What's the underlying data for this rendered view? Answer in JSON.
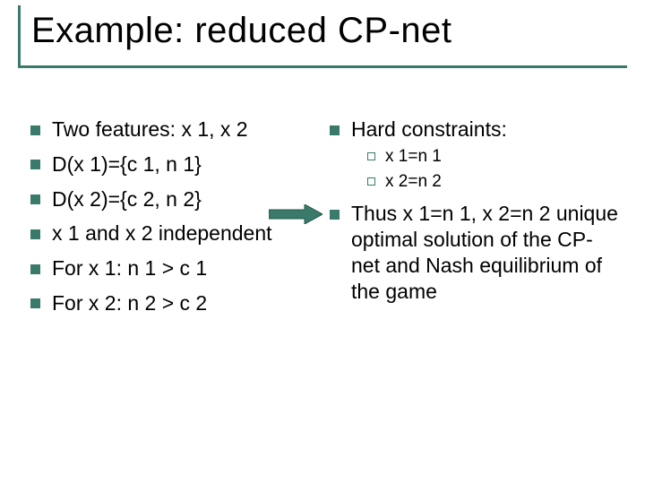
{
  "title": "Example: reduced CP-net",
  "left_items": [
    "Two features: x 1, x 2",
    "D(x 1)={c 1, n 1}",
    "D(x 2)={c 2, n 2}",
    "x 1  and x 2 independent",
    "For x 1: n 1 > c 1",
    "For x 2: n 2 > c 2"
  ],
  "right": {
    "hard_label": "Hard constraints:",
    "hard_sub": [
      "x 1=n 1",
      "x 2=n 2"
    ],
    "conclusion": "Thus x 1=n 1, x 2=n 2 unique optimal solution of the CP-net and Nash equilibrium of the game"
  },
  "colors": {
    "accent": "#3a7a6b"
  }
}
